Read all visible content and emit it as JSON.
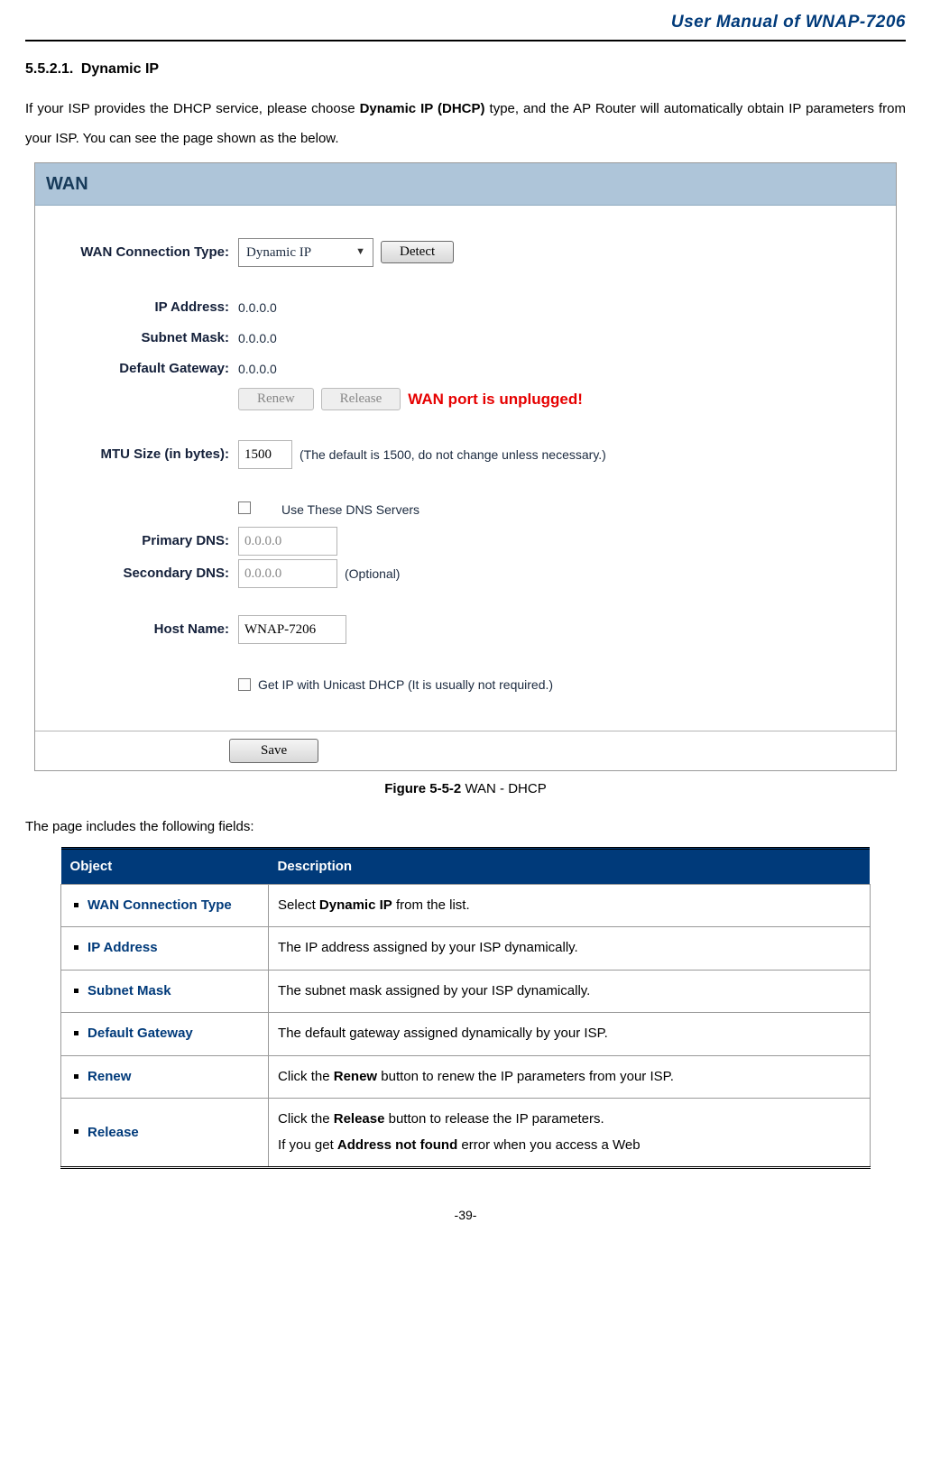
{
  "header": {
    "doc_title": "User Manual of WNAP-7206"
  },
  "section": {
    "number": "5.5.2.1.",
    "title": "Dynamic IP"
  },
  "intro": {
    "pre": "If your ISP provides the DHCP service, please choose ",
    "bold": "Dynamic IP (DHCP)",
    "post": " type, and the AP Router will automatically obtain IP parameters from your ISP. You can see the page shown as the below."
  },
  "wan": {
    "panel_title": "WAN",
    "labels": {
      "conn_type": "WAN Connection Type:",
      "ip": "IP Address:",
      "mask": "Subnet Mask:",
      "gateway": "Default Gateway:",
      "mtu": "MTU Size (in bytes):",
      "dns_use": "Use These DNS Servers",
      "primary_dns": "Primary DNS:",
      "secondary_dns": "Secondary DNS:",
      "host": "Host Name:",
      "unicast": "Get IP with Unicast DHCP (It is usually not required.)"
    },
    "values": {
      "conn_type": "Dynamic IP",
      "ip": "0.0.0.0",
      "mask": "0.0.0.0",
      "gateway": "0.0.0.0",
      "mtu": "1500",
      "mtu_note": "(The default is 1500, do not change unless necessary.)",
      "primary_dns": "0.0.0.0",
      "secondary_dns": "0.0.0.0",
      "secondary_note": "(Optional)",
      "host": "WNAP-7206"
    },
    "buttons": {
      "detect": "Detect",
      "renew": "Renew",
      "release": "Release",
      "save": "Save"
    },
    "warning": "WAN port is unplugged!"
  },
  "figure": {
    "label": "Figure 5-5-2",
    "caption": " WAN - DHCP"
  },
  "fields_intro": "The page includes the following fields:",
  "table": {
    "head_object": "Object",
    "head_desc": "Description",
    "rows": [
      {
        "obj": "WAN Connection Type",
        "desc_pre": "Select ",
        "desc_bold": "Dynamic IP",
        "desc_post": " from the list."
      },
      {
        "obj": "IP Address",
        "desc_pre": "The IP address assigned by your ISP dynamically.",
        "desc_bold": "",
        "desc_post": ""
      },
      {
        "obj": "Subnet Mask",
        "desc_pre": "The subnet mask assigned by your ISP dynamically.",
        "desc_bold": "",
        "desc_post": ""
      },
      {
        "obj": "Default Gateway",
        "desc_pre": "The default gateway assigned dynamically by your ISP.",
        "desc_bold": "",
        "desc_post": ""
      },
      {
        "obj": "Renew",
        "desc_pre": "Click the ",
        "desc_bold": "Renew",
        "desc_post": " button to renew the IP parameters from your ISP."
      },
      {
        "obj": "Release",
        "desc_pre": "Click the ",
        "desc_bold": "Release",
        "desc_post": " button to release the IP parameters.",
        "extra_pre": "If you get ",
        "extra_bold": "Address not found",
        "extra_post": " error when you access a Web"
      }
    ]
  },
  "page_number": "-39-"
}
